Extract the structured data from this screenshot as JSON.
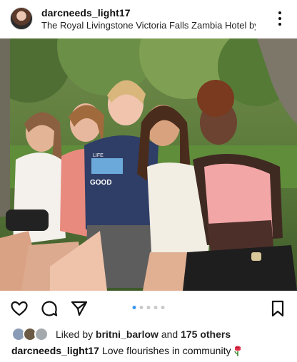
{
  "post": {
    "username": "darcneeds_light17",
    "location": "The Royal Livingstone Victoria Falls Zambia Hotel by",
    "carousel": {
      "count": 5,
      "active_index": 0
    },
    "likes": {
      "prefix": "Liked by ",
      "user": "britni_barlow",
      "middle": " and ",
      "others": "175 others"
    },
    "caption": {
      "username": "darcneeds_light17",
      "text": "Love flourishes in community",
      "emoji": "rose-icon"
    }
  },
  "photo": {
    "shirt_text_1": "LIFE",
    "shirt_text_2": "GOOD"
  },
  "icons": [
    "more-options-icon",
    "heart-icon",
    "comment-icon",
    "share-icon",
    "bookmark-icon"
  ]
}
